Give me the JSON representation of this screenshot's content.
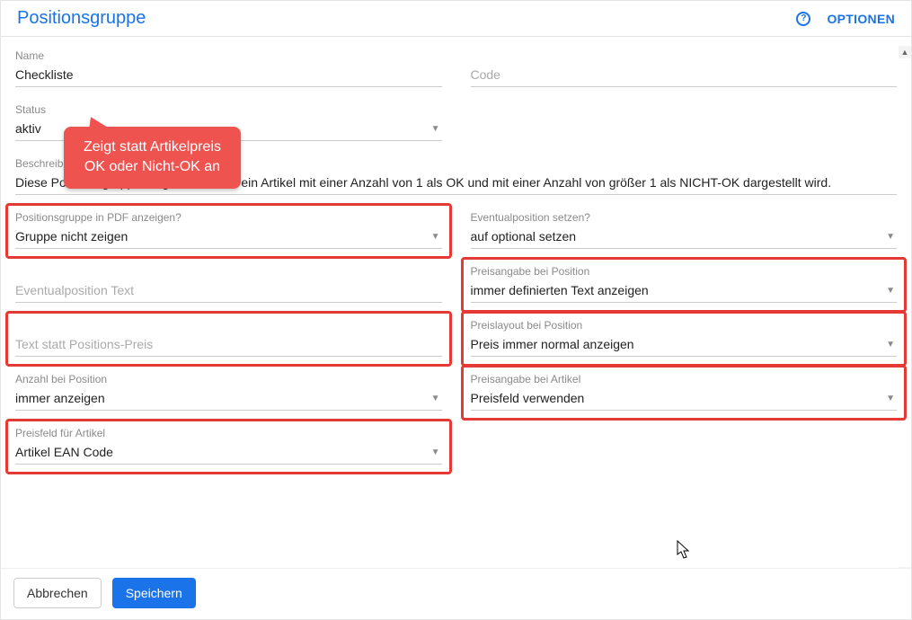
{
  "header": {
    "title": "Positionsgruppe",
    "options": "OPTIONEN",
    "help_glyph": "?"
  },
  "callout": {
    "line1": "Zeigt statt Artikelpreis",
    "line2": "OK oder Nicht-OK an"
  },
  "fields": {
    "name": {
      "label": "Name",
      "value": "Checkliste"
    },
    "code": {
      "label": "",
      "placeholder": "Code"
    },
    "status": {
      "label": "Status",
      "value": "aktiv"
    },
    "beschreibung": {
      "label": "Beschreibung",
      "value": "Diese Positionsgruppe sorgt dafür, dass ein Artikel mit einer Anzahl von 1 als OK und mit einer Anzahl von größer 1 als NICHT-OK dargestellt wird."
    },
    "pdf_anzeigen": {
      "label": "Positionsgruppe in PDF anzeigen?",
      "value": "Gruppe nicht zeigen"
    },
    "eventualposition_setzen": {
      "label": "Eventualposition setzen?",
      "value": "auf optional setzen"
    },
    "eventualposition_text": {
      "label": "",
      "placeholder": "Eventualposition Text"
    },
    "preisangabe_position": {
      "label": "Preisangabe bei Position",
      "value": "immer definierten Text anzeigen"
    },
    "text_statt_preis": {
      "label": "",
      "placeholder": "Text statt Positions-Preis"
    },
    "preislayout_position": {
      "label": "Preislayout bei Position",
      "value": "Preis immer normal anzeigen"
    },
    "anzahl_position": {
      "label": "Anzahl bei Position",
      "value": "immer anzeigen"
    },
    "preisangabe_artikel": {
      "label": "Preisangabe bei Artikel",
      "value": "Preisfeld verwenden"
    },
    "preisfeld_artikel": {
      "label": "Preisfeld für Artikel",
      "value": "Artikel EAN Code"
    }
  },
  "footer": {
    "cancel": "Abbrechen",
    "save": "Speichern"
  },
  "colors": {
    "primary": "#1a73e8",
    "highlight": "#e53935",
    "callout": "#ef5350"
  }
}
